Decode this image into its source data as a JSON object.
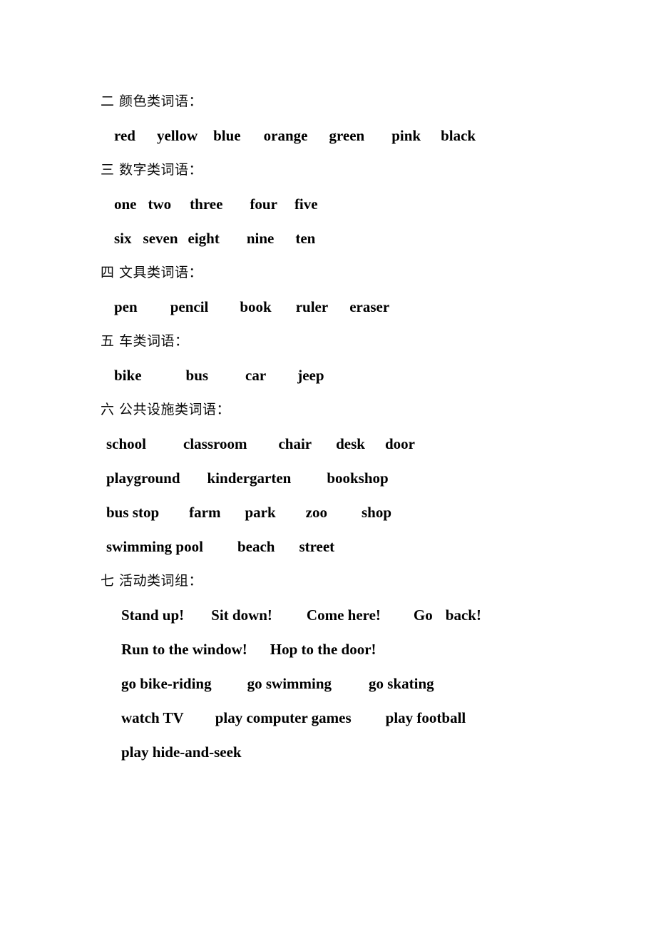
{
  "document": {
    "page_background": "#ffffff",
    "text_color": "#000000"
  },
  "sections": [
    {
      "id": "colors",
      "heading": "二 颜色类词语：",
      "indent": "indent-a",
      "rows": [
        {
          "words": [
            "red",
            "yellow",
            "blue",
            "orange",
            "green",
            "pink",
            "black"
          ],
          "gaps": [
            30,
            22,
            32,
            30,
            38,
            28
          ]
        }
      ]
    },
    {
      "id": "numbers",
      "heading": "三 数字类词语：",
      "indent": "indent-a",
      "rows": [
        {
          "words": [
            "one",
            "two",
            "three",
            "four",
            "five"
          ],
          "gaps": [
            16,
            26,
            38,
            24
          ]
        },
        {
          "words": [
            "six",
            "seven",
            "eight",
            "nine",
            "ten"
          ],
          "gaps": [
            16,
            14,
            38,
            30
          ]
        }
      ]
    },
    {
      "id": "stationery",
      "heading": "四 文具类词语：",
      "indent": "indent-a",
      "rows": [
        {
          "words": [
            "pen",
            "pencil",
            "book",
            "ruler",
            "eraser"
          ],
          "gaps": [
            46,
            44,
            34,
            30
          ]
        }
      ]
    },
    {
      "id": "vehicles",
      "heading": "五 车类词语：",
      "indent": "indent-a",
      "rows": [
        {
          "words": [
            "bike",
            "bus",
            "car",
            "jeep"
          ],
          "gaps": [
            62,
            52,
            44
          ]
        }
      ]
    },
    {
      "id": "public-facilities",
      "heading": "六 公共设施类词语：",
      "indent": "indent-b",
      "rows": [
        {
          "words": [
            "school",
            "classroom",
            "chair",
            "desk",
            "door"
          ],
          "gaps": [
            52,
            44,
            34,
            28
          ]
        },
        {
          "words": [
            "playground",
            "kindergarten",
            "bookshop"
          ],
          "gaps": [
            38,
            50
          ]
        },
        {
          "words": [
            "bus stop",
            "farm",
            "park",
            "zoo",
            "shop"
          ],
          "gaps": [
            42,
            34,
            42,
            48
          ]
        },
        {
          "words": [
            "swimming pool",
            "beach",
            "street"
          ],
          "gaps": [
            48,
            34
          ]
        }
      ]
    },
    {
      "id": "activities",
      "heading": "七 活动类词组：",
      "indent": "indent-c",
      "rows": [
        {
          "words": [
            "Stand up!",
            "Sit down!",
            "Come here!",
            "Go",
            "back!"
          ],
          "gaps": [
            38,
            48,
            46,
            18
          ]
        },
        {
          "words": [
            "Run to the window!",
            "Hop to the door!"
          ],
          "gaps": [
            32
          ]
        },
        {
          "words": [
            "go bike-riding",
            "go swimming",
            "go skating"
          ],
          "gaps": [
            50,
            52
          ]
        },
        {
          "words": [
            "watch TV",
            "play computer games",
            "play football"
          ],
          "gaps": [
            44,
            48
          ]
        },
        {
          "words": [
            "play hide-and-seek"
          ],
          "gaps": []
        }
      ]
    }
  ]
}
